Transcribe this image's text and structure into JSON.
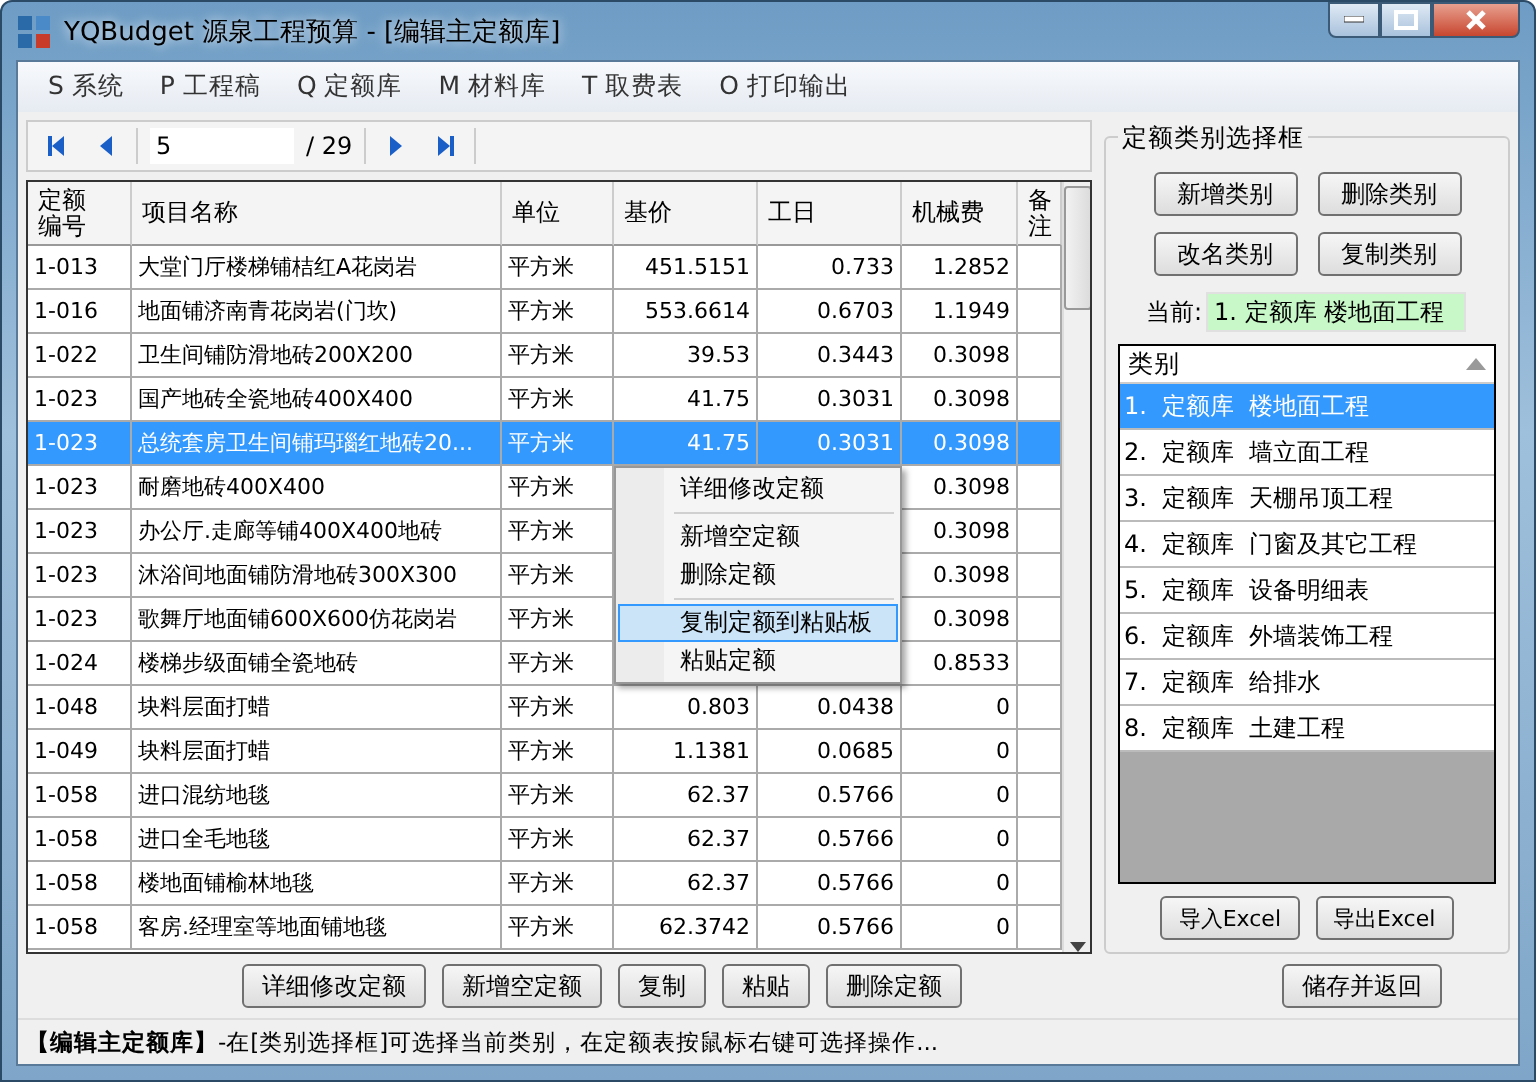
{
  "window": {
    "title": "YQBudget 源泉工程预算 - [编辑主定额库]"
  },
  "menu_bar": [
    "S 系统",
    "P 工程稿",
    "Q 定额库",
    "M 材料库",
    "T 取费表",
    "O 打印输出"
  ],
  "pager": {
    "page": "5",
    "total": "/ 29"
  },
  "table": {
    "columns": [
      "定额编号",
      "项目名称",
      "单位",
      "基价",
      "工日",
      "机械费",
      "备注"
    ],
    "rows": [
      {
        "selected": false,
        "code": "1-013",
        "name": "大堂门厅楼梯铺桔红A花岗岩",
        "unit": "平方米",
        "price": "451.5151",
        "labor": "0.733",
        "machine": "1.2852"
      },
      {
        "selected": false,
        "code": "1-016",
        "name": "地面铺济南青花岗岩(门坎)",
        "unit": "平方米",
        "price": "553.6614",
        "labor": "0.6703",
        "machine": "1.1949"
      },
      {
        "selected": false,
        "code": "1-022",
        "name": "卫生间铺防滑地砖200X200",
        "unit": "平方米",
        "price": "39.53",
        "labor": "0.3443",
        "machine": "0.3098"
      },
      {
        "selected": false,
        "code": "1-023",
        "name": "国产地砖全瓷地砖400X400",
        "unit": "平方米",
        "price": "41.75",
        "labor": "0.3031",
        "machine": "0.3098"
      },
      {
        "selected": true,
        "code": "1-023",
        "name": "总统套房卫生间铺玛瑙红地砖20...",
        "unit": "平方米",
        "price": "41.75",
        "labor": "0.3031",
        "machine": "0.3098"
      },
      {
        "selected": false,
        "code": "1-023",
        "name": "耐磨地砖400X400",
        "unit": "平方米",
        "machine": "0.3098"
      },
      {
        "selected": false,
        "code": "1-023",
        "name": "办公厅.走廊等铺400X400地砖",
        "unit": "平方米",
        "machine": "0.3098"
      },
      {
        "selected": false,
        "code": "1-023",
        "name": "沐浴间地面铺防滑地砖300X300",
        "unit": "平方米",
        "machine": "0.3098"
      },
      {
        "selected": false,
        "code": "1-023",
        "name": "歌舞厅地面铺600X600仿花岗岩",
        "unit": "平方米",
        "machine": "0.3098"
      },
      {
        "selected": false,
        "code": "1-024",
        "name": "楼梯步级面铺全瓷地砖",
        "unit": "平方米",
        "machine": "0.8533"
      },
      {
        "selected": false,
        "code": "1-048",
        "name": "块料层面打蜡",
        "unit": "平方米",
        "price": "0.803",
        "labor": "0.0438",
        "machine": "0"
      },
      {
        "selected": false,
        "code": "1-049",
        "name": "块料层面打蜡",
        "unit": "平方米",
        "price": "1.1381",
        "labor": "0.0685",
        "machine": "0"
      },
      {
        "selected": false,
        "code": "1-058",
        "name": "进口混纺地毯",
        "unit": "平方米",
        "price": "62.37",
        "labor": "0.5766",
        "machine": "0"
      },
      {
        "selected": false,
        "code": "1-058",
        "name": "进口全毛地毯",
        "unit": "平方米",
        "price": "62.37",
        "labor": "0.5766",
        "machine": "0"
      },
      {
        "selected": false,
        "code": "1-058",
        "name": "楼地面铺榆林地毯",
        "unit": "平方米",
        "price": "62.37",
        "labor": "0.5766",
        "machine": "0"
      },
      {
        "selected": false,
        "code": "1-058",
        "name": "客房.经理室等地面铺地毯",
        "unit": "平方米",
        "price": "62.3742",
        "labor": "0.5766",
        "machine": "0"
      }
    ]
  },
  "context_menu": {
    "groups": [
      [
        {
          "label": "详细修改定额",
          "selected": false
        }
      ],
      [
        {
          "label": "新增空定额",
          "selected": false
        },
        {
          "label": "删除定额",
          "selected": false
        }
      ],
      [
        {
          "label": "复制定额到粘贴板",
          "selected": true
        },
        {
          "label": "粘贴定额",
          "selected": false
        }
      ]
    ]
  },
  "bottom_buttons": [
    "详细修改定额",
    "新增空定额",
    "复制",
    "粘贴",
    "删除定额"
  ],
  "category_panel": {
    "title": "定额类别选择框",
    "buttons": [
      "新增类别",
      "删除类别",
      "改名类别",
      "复制类别"
    ],
    "current_label": "当前:",
    "current_value": "1. 定额库 楼地面工程",
    "list_header": "类别",
    "items": [
      {
        "label": "1.  定额库  楼地面工程",
        "selected": true
      },
      {
        "label": "2.  定额库  墙立面工程",
        "selected": false
      },
      {
        "label": "3.  定额库  天棚吊顶工程",
        "selected": false
      },
      {
        "label": "4.  定额库  门窗及其它工程",
        "selected": false
      },
      {
        "label": "5.  定额库  设备明细表",
        "selected": false
      },
      {
        "label": "6.  定额库  外墙装饰工程",
        "selected": false
      },
      {
        "label": "7.  定额库  给排水",
        "selected": false
      },
      {
        "label": "8.  定额库  土建工程",
        "selected": false
      }
    ],
    "excel_buttons": [
      "导入Excel",
      "导出Excel"
    ]
  },
  "save_button": "储存并返回",
  "status_bar": "**【编辑主定额库】**-在[类别选择框]可选择当前类别，在定额表按鼠标右键可选择操作..."
}
